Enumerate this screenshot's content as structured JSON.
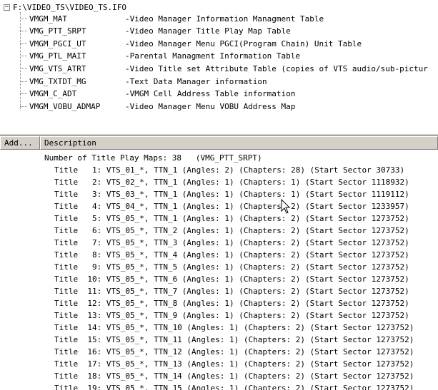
{
  "tree": {
    "root_label": "F:\\VIDEO_TS\\VIDEO_TS.IFO",
    "expander_glyph": "−",
    "items": [
      {
        "name": "VMGM_MAT",
        "desc": "-Video Manager Information Managment Table"
      },
      {
        "name": "VMG_PTT_SRPT",
        "desc": "-Video Manager Title Play Map Table"
      },
      {
        "name": "VMGM_PGCI_UT",
        "desc": "-Video Manager Menu PGCI(Program Chain) Unit Table"
      },
      {
        "name": "VMG_PTL_MAIT",
        "desc": "-Parental Managment Information Table"
      },
      {
        "name": "VMG_VTS_ATRT",
        "desc": "-Video Title set Attribute Table (copies of VTS audio/sub-pictur"
      },
      {
        "name": "VMG_TXTDT_MG",
        "desc": "-Text Data Manager information"
      },
      {
        "name": "VMGM_C_ADT",
        "desc": "-VMGM Cell Address Table information"
      },
      {
        "name": "VMGM_VOBU_ADMAP",
        "desc": "-Video Manager Menu VOBU Address Map"
      }
    ]
  },
  "columns": {
    "add": "Add...",
    "description": "Description"
  },
  "list": {
    "summary": "Number of Title Play Maps: 38   (VMG_PTT_SRPT)",
    "rows": [
      "Title   1: VTS_01_*, TTN_1 (Angles: 2) (Chapters: 28) (Start Sector 30733)",
      "Title   2: VTS_02_*, TTN_1 (Angles: 1) (Chapters: 1) (Start Sector 1118932)",
      "Title   3: VTS_03_*, TTN_1 (Angles: 1) (Chapters: 1) (Start Sector 1119112)",
      "Title   4: VTS_04_*, TTN_1 (Angles: 1) (Chapters: 2) (Start Sector 1233957)",
      "Title   5: VTS_05_*, TTN_1 (Angles: 1) (Chapters: 2) (Start Sector 1273752)",
      "Title   6: VTS_05_*, TTN_2 (Angles: 1) (Chapters: 2) (Start Sector 1273752)",
      "Title   7: VTS_05_*, TTN_3 (Angles: 1) (Chapters: 2) (Start Sector 1273752)",
      "Title   8: VTS_05_*, TTN_4 (Angles: 1) (Chapters: 2) (Start Sector 1273752)",
      "Title   9: VTS_05_*, TTN_5 (Angles: 1) (Chapters: 2) (Start Sector 1273752)",
      "Title  10: VTS_05_*, TTN_6 (Angles: 1) (Chapters: 2) (Start Sector 1273752)",
      "Title  11: VTS_05_*, TTN_7 (Angles: 1) (Chapters: 2) (Start Sector 1273752)",
      "Title  12: VTS_05_*, TTN_8 (Angles: 1) (Chapters: 2) (Start Sector 1273752)",
      "Title  13: VTS_05_*, TTN_9 (Angles: 1) (Chapters: 2) (Start Sector 1273752)",
      "Title  14: VTS_05_*, TTN_10 (Angles: 1) (Chapters: 2) (Start Sector 1273752)",
      "Title  15: VTS_05_*, TTN_11 (Angles: 1) (Chapters: 2) (Start Sector 1273752)",
      "Title  16: VTS_05_*, TTN_12 (Angles: 1) (Chapters: 2) (Start Sector 1273752)",
      "Title  17: VTS_05_*, TTN_13 (Angles: 1) (Chapters: 2) (Start Sector 1273752)",
      "Title  18: VTS_05_*, TTN_14 (Angles: 1) (Chapters: 2) (Start Sector 1273752)",
      "Title  19: VTS_05_*, TTN_15 (Angles: 1) (Chapters: 2) (Start Sector 1273752)"
    ]
  },
  "cursor_icon": "mouse-pointer-icon"
}
